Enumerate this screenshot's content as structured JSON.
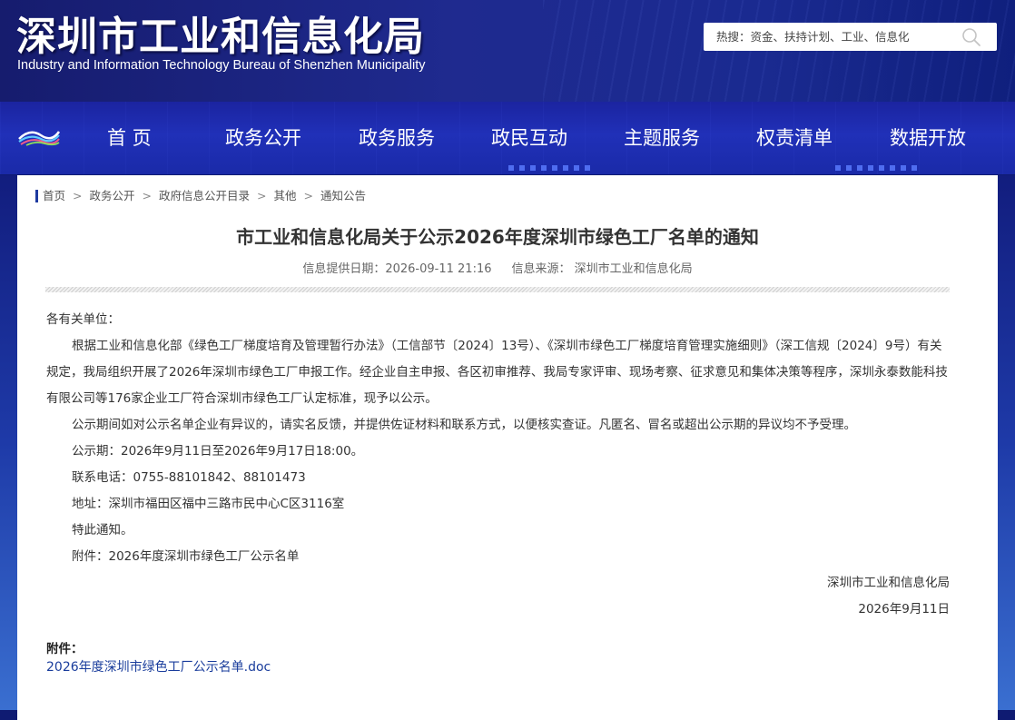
{
  "header": {
    "title": "深圳市工业和信息化局",
    "subtitle": "Industry and Information Technology Bureau of Shenzhen Municipality",
    "search_placeholder": "热搜：资金、扶持计划、工业、信息化"
  },
  "nav": {
    "items": [
      "首 页",
      "政务公开",
      "政务服务",
      "政民互动",
      "主题服务",
      "权责清单",
      "数据开放"
    ]
  },
  "breadcrumb": [
    "首页",
    "政务公开",
    "政府信息公开目录",
    "其他",
    "通知公告"
  ],
  "article": {
    "title": "市工业和信息化局关于公示2026年度深圳市绿色工厂名单的通知",
    "meta_date": "信息提供日期：2026-09-11 21:16",
    "meta_source": "信息来源：  深圳市工业和信息化局",
    "salutation": "各有关单位：",
    "paragraph1": "根据工业和信息化部《绿色工厂梯度培育及管理暂行办法》（工信部节〔2024〕13号）、《深圳市绿色工厂梯度培育管理实施细则》（深工信规〔2024〕9号）有关规定，我局组织开展了2026年深圳市绿色工厂申报工作。经企业自主申报、各区初审推荐、我局专家评审、现场考察、征求意见和集体决策等程序，深圳永泰数能科技有限公司等176家企业工厂符合深圳市绿色工厂认定标准，现予以公示。",
    "paragraph2": "公示期间如对公示名单企业有异议的，请实名反馈，并提供佐证材料和联系方式，以便核实查证。凡匿名、冒名或超出公示期的异议均不予受理。",
    "period": "公示期：2026年9月11日至2026年9月17日18:00。",
    "phone": "联系电话：0755-88101842、88101473",
    "address": "地址：深圳市福田区福中三路市民中心C区3116室",
    "closing": "特此通知。",
    "attachment_line": "附件：2026年度深圳市绿色工厂公示名单",
    "signature_org": "深圳市工业和信息化局",
    "signature_date": "2026年9月11日"
  },
  "attachments": {
    "label": "附件：",
    "file": "2026年度深圳市绿色工厂公示名单.doc"
  },
  "colors": {
    "header_bg": "#1f2a8f",
    "nav_bg": "#2030b8",
    "accent": "#1e3aa0",
    "link": "#1a3d9c"
  }
}
